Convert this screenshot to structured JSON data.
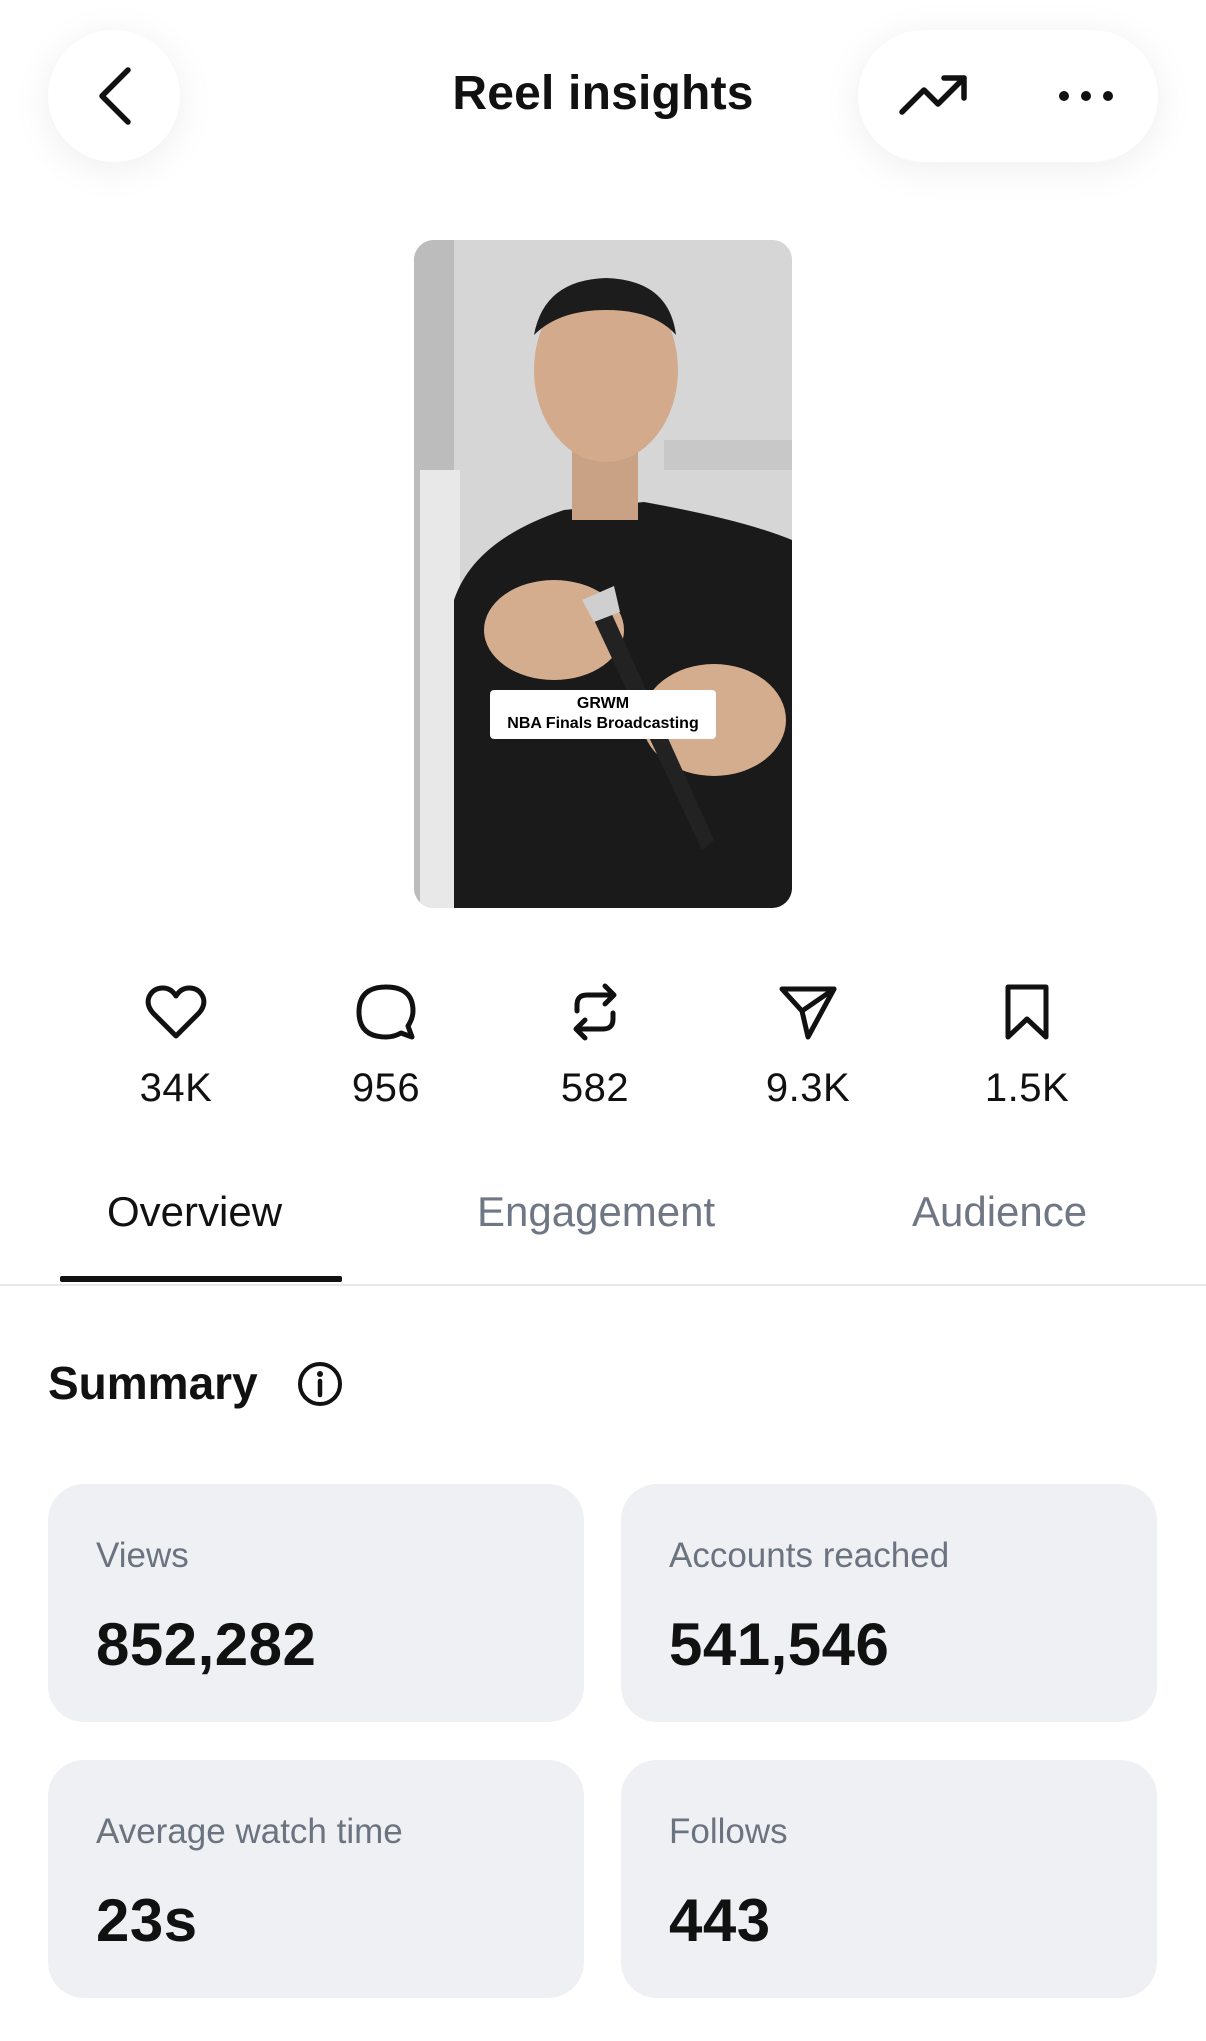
{
  "header": {
    "title": "Reel insights",
    "back_icon": "chevron-left-icon",
    "trend_icon": "trending-up-icon",
    "more_icon": "more-horizontal-icon"
  },
  "reel": {
    "caption_line1": "GRWM",
    "caption_line2": "NBA Finals Broadcasting"
  },
  "stats": [
    {
      "name": "likes",
      "icon": "heart-icon",
      "value": "34K"
    },
    {
      "name": "comments",
      "icon": "comment-icon",
      "value": "956"
    },
    {
      "name": "reposts",
      "icon": "repost-icon",
      "value": "582"
    },
    {
      "name": "shares",
      "icon": "send-icon",
      "value": "9.3K"
    },
    {
      "name": "saves",
      "icon": "bookmark-icon",
      "value": "1.5K"
    }
  ],
  "tabs": [
    {
      "label": "Overview",
      "active": true
    },
    {
      "label": "Engagement",
      "active": false
    },
    {
      "label": "Audience",
      "active": false
    }
  ],
  "summary": {
    "title": "Summary",
    "cards": [
      {
        "label": "Views",
        "value": "852,282"
      },
      {
        "label": "Accounts reached",
        "value": "541,546"
      },
      {
        "label": "Average watch time",
        "value": "23s"
      },
      {
        "label": "Follows",
        "value": "443"
      }
    ]
  },
  "colors": {
    "text_primary": "#111111",
    "text_secondary": "#6c7380",
    "card_bg": "#eff0f3"
  }
}
